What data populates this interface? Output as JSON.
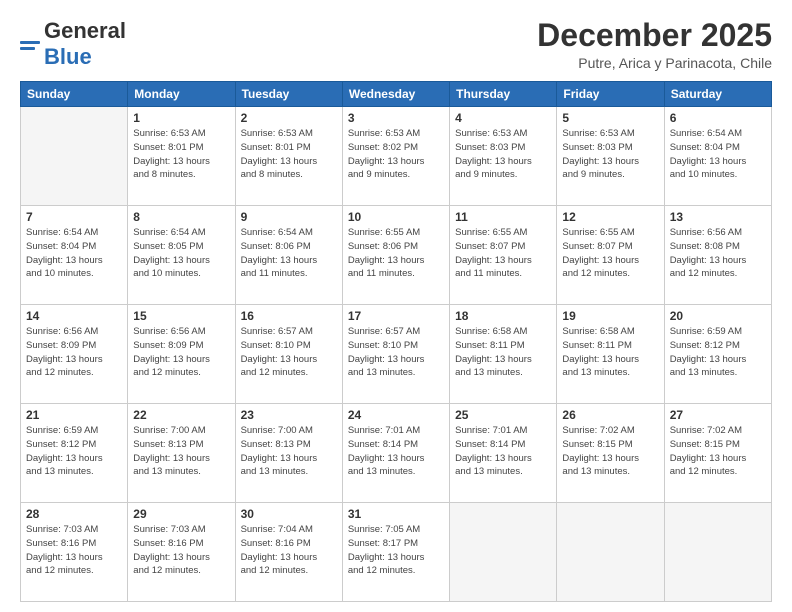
{
  "header": {
    "logo_general": "General",
    "logo_blue": "Blue",
    "month": "December 2025",
    "location": "Putre, Arica y Parinacota, Chile"
  },
  "days_of_week": [
    "Sunday",
    "Monday",
    "Tuesday",
    "Wednesday",
    "Thursday",
    "Friday",
    "Saturday"
  ],
  "weeks": [
    [
      {
        "day": "",
        "info": ""
      },
      {
        "day": "1",
        "info": "Sunrise: 6:53 AM\nSunset: 8:01 PM\nDaylight: 13 hours\nand 8 minutes."
      },
      {
        "day": "2",
        "info": "Sunrise: 6:53 AM\nSunset: 8:01 PM\nDaylight: 13 hours\nand 8 minutes."
      },
      {
        "day": "3",
        "info": "Sunrise: 6:53 AM\nSunset: 8:02 PM\nDaylight: 13 hours\nand 9 minutes."
      },
      {
        "day": "4",
        "info": "Sunrise: 6:53 AM\nSunset: 8:03 PM\nDaylight: 13 hours\nand 9 minutes."
      },
      {
        "day": "5",
        "info": "Sunrise: 6:53 AM\nSunset: 8:03 PM\nDaylight: 13 hours\nand 9 minutes."
      },
      {
        "day": "6",
        "info": "Sunrise: 6:54 AM\nSunset: 8:04 PM\nDaylight: 13 hours\nand 10 minutes."
      }
    ],
    [
      {
        "day": "7",
        "info": "Sunrise: 6:54 AM\nSunset: 8:04 PM\nDaylight: 13 hours\nand 10 minutes."
      },
      {
        "day": "8",
        "info": "Sunrise: 6:54 AM\nSunset: 8:05 PM\nDaylight: 13 hours\nand 10 minutes."
      },
      {
        "day": "9",
        "info": "Sunrise: 6:54 AM\nSunset: 8:06 PM\nDaylight: 13 hours\nand 11 minutes."
      },
      {
        "day": "10",
        "info": "Sunrise: 6:55 AM\nSunset: 8:06 PM\nDaylight: 13 hours\nand 11 minutes."
      },
      {
        "day": "11",
        "info": "Sunrise: 6:55 AM\nSunset: 8:07 PM\nDaylight: 13 hours\nand 11 minutes."
      },
      {
        "day": "12",
        "info": "Sunrise: 6:55 AM\nSunset: 8:07 PM\nDaylight: 13 hours\nand 12 minutes."
      },
      {
        "day": "13",
        "info": "Sunrise: 6:56 AM\nSunset: 8:08 PM\nDaylight: 13 hours\nand 12 minutes."
      }
    ],
    [
      {
        "day": "14",
        "info": "Sunrise: 6:56 AM\nSunset: 8:09 PM\nDaylight: 13 hours\nand 12 minutes."
      },
      {
        "day": "15",
        "info": "Sunrise: 6:56 AM\nSunset: 8:09 PM\nDaylight: 13 hours\nand 12 minutes."
      },
      {
        "day": "16",
        "info": "Sunrise: 6:57 AM\nSunset: 8:10 PM\nDaylight: 13 hours\nand 12 minutes."
      },
      {
        "day": "17",
        "info": "Sunrise: 6:57 AM\nSunset: 8:10 PM\nDaylight: 13 hours\nand 13 minutes."
      },
      {
        "day": "18",
        "info": "Sunrise: 6:58 AM\nSunset: 8:11 PM\nDaylight: 13 hours\nand 13 minutes."
      },
      {
        "day": "19",
        "info": "Sunrise: 6:58 AM\nSunset: 8:11 PM\nDaylight: 13 hours\nand 13 minutes."
      },
      {
        "day": "20",
        "info": "Sunrise: 6:59 AM\nSunset: 8:12 PM\nDaylight: 13 hours\nand 13 minutes."
      }
    ],
    [
      {
        "day": "21",
        "info": "Sunrise: 6:59 AM\nSunset: 8:12 PM\nDaylight: 13 hours\nand 13 minutes."
      },
      {
        "day": "22",
        "info": "Sunrise: 7:00 AM\nSunset: 8:13 PM\nDaylight: 13 hours\nand 13 minutes."
      },
      {
        "day": "23",
        "info": "Sunrise: 7:00 AM\nSunset: 8:13 PM\nDaylight: 13 hours\nand 13 minutes."
      },
      {
        "day": "24",
        "info": "Sunrise: 7:01 AM\nSunset: 8:14 PM\nDaylight: 13 hours\nand 13 minutes."
      },
      {
        "day": "25",
        "info": "Sunrise: 7:01 AM\nSunset: 8:14 PM\nDaylight: 13 hours\nand 13 minutes."
      },
      {
        "day": "26",
        "info": "Sunrise: 7:02 AM\nSunset: 8:15 PM\nDaylight: 13 hours\nand 13 minutes."
      },
      {
        "day": "27",
        "info": "Sunrise: 7:02 AM\nSunset: 8:15 PM\nDaylight: 13 hours\nand 12 minutes."
      }
    ],
    [
      {
        "day": "28",
        "info": "Sunrise: 7:03 AM\nSunset: 8:16 PM\nDaylight: 13 hours\nand 12 minutes."
      },
      {
        "day": "29",
        "info": "Sunrise: 7:03 AM\nSunset: 8:16 PM\nDaylight: 13 hours\nand 12 minutes."
      },
      {
        "day": "30",
        "info": "Sunrise: 7:04 AM\nSunset: 8:16 PM\nDaylight: 13 hours\nand 12 minutes."
      },
      {
        "day": "31",
        "info": "Sunrise: 7:05 AM\nSunset: 8:17 PM\nDaylight: 13 hours\nand 12 minutes."
      },
      {
        "day": "",
        "info": ""
      },
      {
        "day": "",
        "info": ""
      },
      {
        "day": "",
        "info": ""
      }
    ]
  ]
}
